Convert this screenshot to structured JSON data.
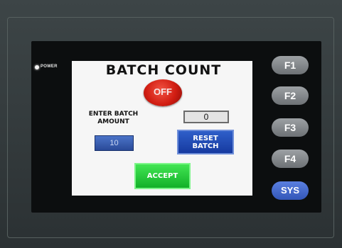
{
  "panel": {
    "power_label": "POWER",
    "function_keys": [
      "F1",
      "F2",
      "F3",
      "F4",
      "SYS"
    ]
  },
  "screen": {
    "title": "BATCH COUNT",
    "status_button": "OFF",
    "enter_label_line1": "ENTER BATCH",
    "enter_label_line2": "AMOUNT",
    "count_value": "0",
    "amount_value": "10",
    "reset_line1": "RESET",
    "reset_line2": "BATCH",
    "accept_label": "ACCEPT"
  },
  "colors": {
    "off_red": "#d11d12",
    "reset_blue": "#163aa0",
    "accept_green": "#12b028",
    "sys_blue": "#3356b8"
  }
}
